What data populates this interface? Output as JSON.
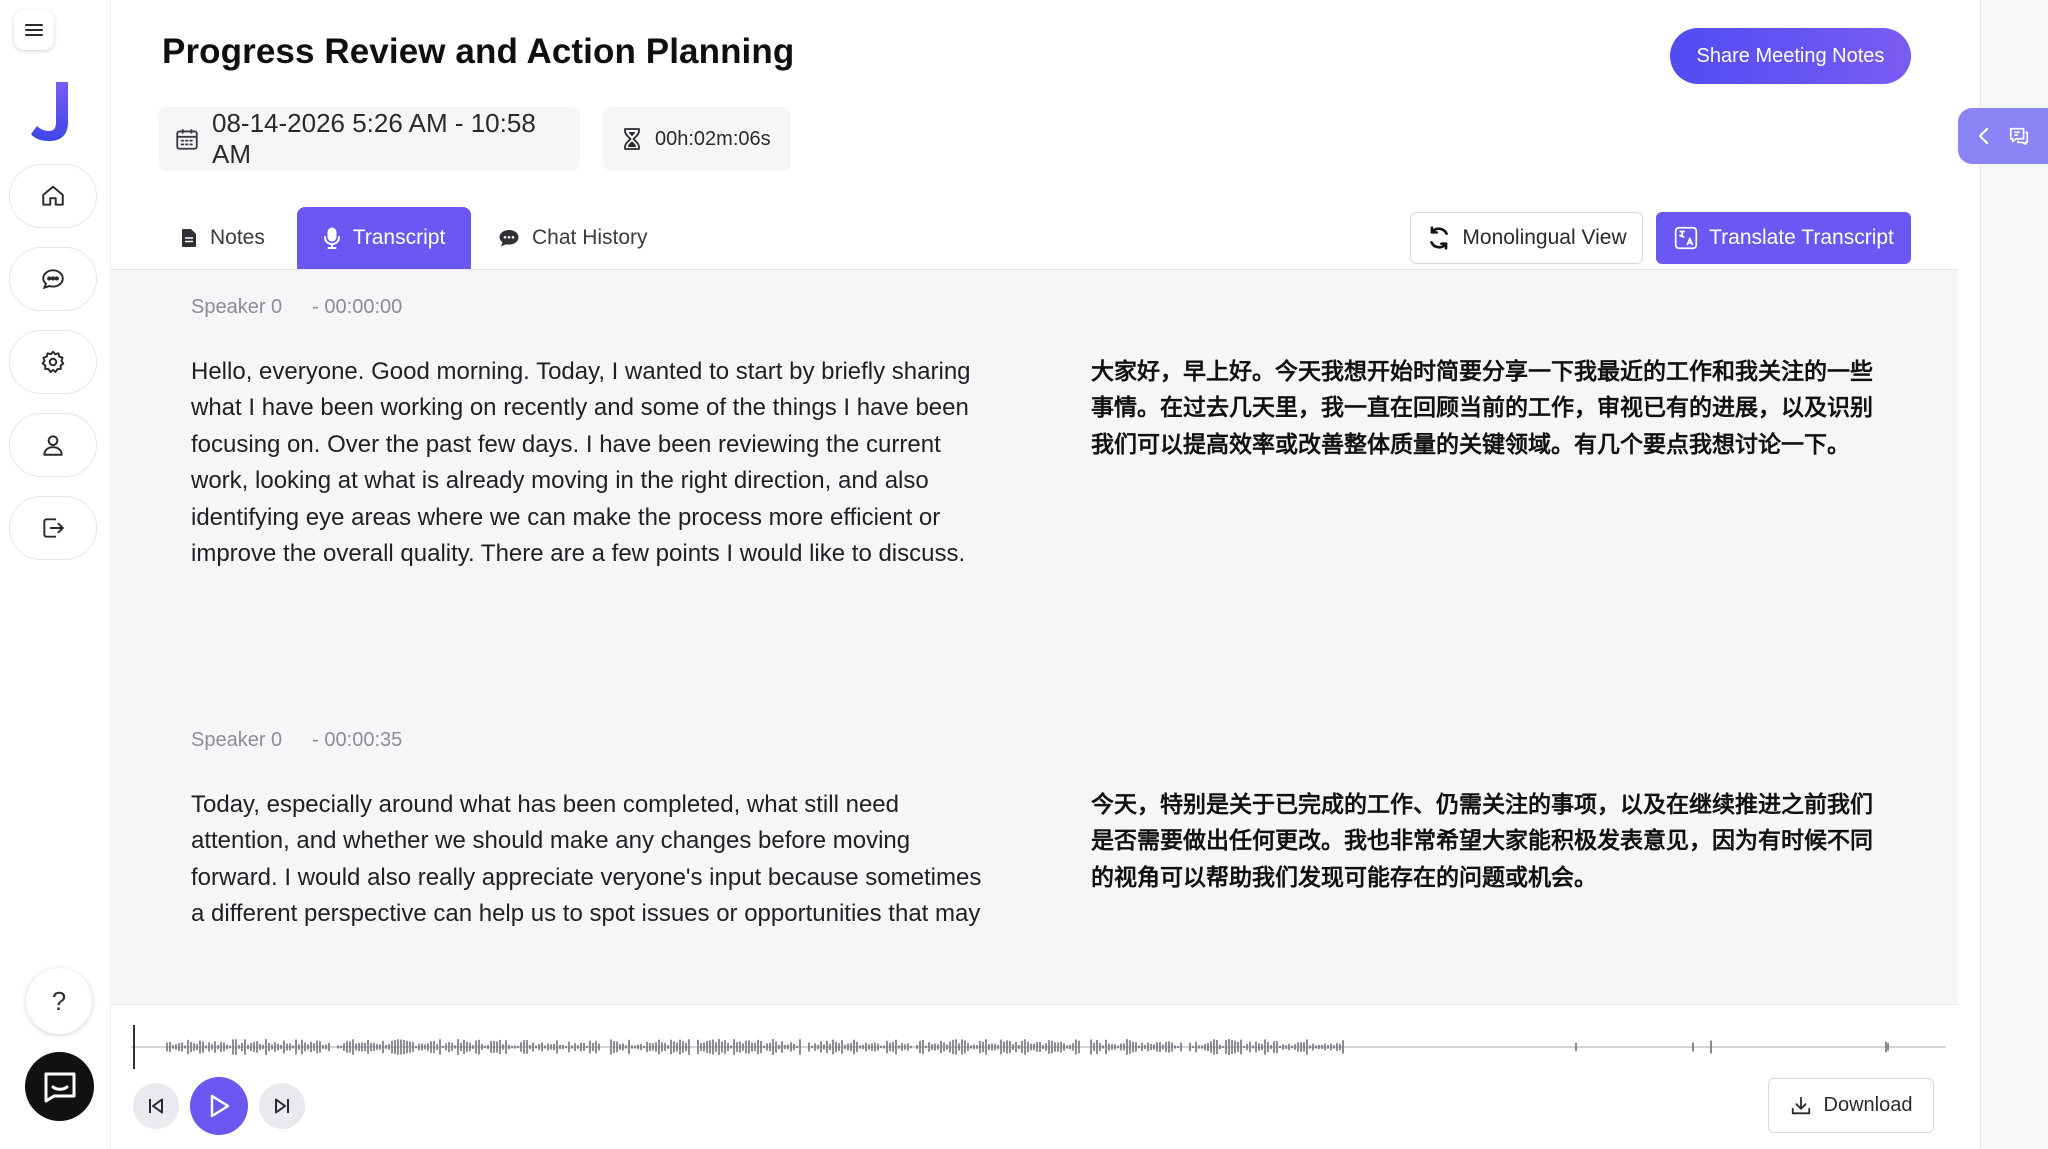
{
  "meeting": {
    "title": "Progress Review and Action Planning",
    "share_label": "Share Meeting Notes",
    "date_range": "08-14-2026 5:26 AM - 10:58 AM",
    "duration": "00h:02m:06s"
  },
  "sidebar": {
    "logo_letter": "J",
    "items": [
      {
        "name": "home",
        "icon": "home-icon"
      },
      {
        "name": "chat",
        "icon": "chat-bubble-icon"
      },
      {
        "name": "settings",
        "icon": "gear-icon"
      },
      {
        "name": "profile",
        "icon": "user-icon"
      },
      {
        "name": "logout",
        "icon": "logout-icon"
      }
    ],
    "help_label": "?"
  },
  "tabs": [
    {
      "label": "Notes",
      "icon": "document-icon",
      "active": false
    },
    {
      "label": "Transcript",
      "icon": "microphone-icon",
      "active": true
    },
    {
      "label": "Chat History",
      "icon": "chat-icon",
      "active": false
    }
  ],
  "toolbar": {
    "monolingual_label": "Monolingual View",
    "translate_label": "Translate Transcript"
  },
  "segments": [
    {
      "speaker": "Speaker 0",
      "timestamp": "- 00:00:00",
      "text": "Hello, everyone. Good morning. Today, I wanted to start by briefly sharing what I have been working on recently and some of the things I have been focusing on. Over the past few days. I have been reviewing the current work, looking at what is already moving in the right direction, and also identifying eye areas where we can make the process more efficient or improve the overall quality. There are a few points I would like to discuss.",
      "translation": "大家好，早上好。今天我想开始时简要分享一下我最近的工作和我关注的一些事情。在过去几天里，我一直在回顾当前的工作，审视已有的进展，以及识别我们可以提高效率或改善整体质量的关键领域。有几个要点我想讨论一下。"
    },
    {
      "speaker": "Speaker 0",
      "timestamp": "- 00:00:35",
      "text": "Today, especially around what has been completed, what still need attention, and whether we should make any changes before moving forward. I would also really appreciate veryone's input because sometimes a different perspective can help us to spot issues or opportunities that may",
      "translation": "今天，特别是关于已完成的工作、仍需关注的事项，以及在继续推进之前我们是否需要做出任何更改。我也非常希望大家能积极发表意见，因为有时候不同的视角可以帮助我们发现可能存在的问题或机会。"
    }
  ],
  "player": {
    "download_label": "Download",
    "playing": false
  },
  "colors": {
    "accent": "#6b58f2",
    "share_gradient_start": "#4f4cf2",
    "share_gradient_end": "#7a5cf3",
    "rail_toggle": "#8b84f6",
    "logo": "#5b54f0",
    "waveform": "#6f7178"
  }
}
